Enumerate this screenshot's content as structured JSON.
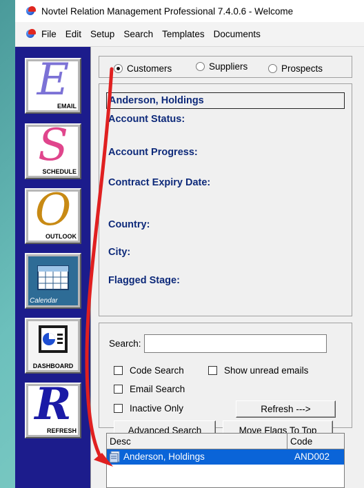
{
  "window": {
    "title": "Novtel Relation Management Professional 7.4.0.6 - Welcome"
  },
  "menu": [
    "File",
    "Edit",
    "Setup",
    "Search",
    "Templates",
    "Documents"
  ],
  "launcher": [
    {
      "letter": "E",
      "label": "EMAIL",
      "color": "#7c72d6"
    },
    {
      "letter": "S",
      "label": "SCHEDULE",
      "color": "#e0458c"
    },
    {
      "letter": "O",
      "label": "OUTLOOK",
      "color": "#c88a14"
    },
    {
      "icon": "calendar-icon",
      "label": "Calendar"
    },
    {
      "icon": "dashboard-icon",
      "label": "DASHBOARD"
    },
    {
      "letter": "R",
      "label": "REFRESH",
      "color": "#1a1aa6"
    }
  ],
  "record_type": {
    "options": [
      "Customers",
      "Suppliers",
      "Prospects"
    ],
    "selected": "Customers"
  },
  "customer": {
    "name": "Anderson, Holdings",
    "labels": {
      "account_status": "Account Status:",
      "account_progress": "Account Progress:",
      "contract_expiry": "Contract Expiry Date:",
      "country": "Country:",
      "city": "City:",
      "flagged_stage": "Flagged Stage:"
    }
  },
  "search": {
    "label": "Search:",
    "value": "",
    "code_search": {
      "label": "Code Search",
      "checked": false
    },
    "show_unread": {
      "label": "Show unread emails",
      "checked": false
    },
    "email_search": {
      "label": "Email Search",
      "checked": false
    },
    "inactive_only": {
      "label": "Inactive Only",
      "checked": false
    },
    "refresh_button": "Refresh --->",
    "advanced_button": "Advanced Search",
    "move_flags_button": "Move Flags To Top"
  },
  "grid": {
    "columns": [
      "Desc",
      "Code"
    ],
    "rows": [
      {
        "desc": "Anderson, Holdings",
        "code": "AND002"
      }
    ]
  },
  "colors": {
    "launcher_bg": "#1c1c8c",
    "label_blue": "#0e2a7a",
    "selection": "#0a64d8",
    "annotation_arrow": "#e02020"
  }
}
